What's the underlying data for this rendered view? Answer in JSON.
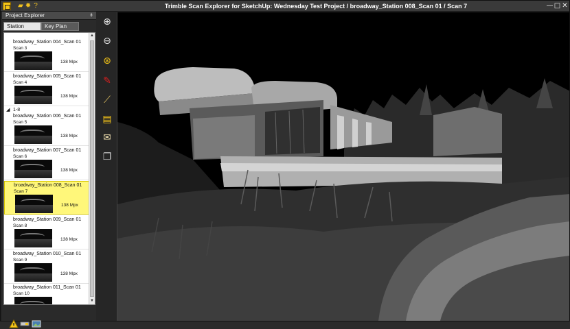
{
  "window": {
    "title": "Trimble Scan Explorer for SketchUp: Wednesday Test Project / broadway_Station 008_Scan 01 / Scan 7",
    "app_icon": "trimble-app-icon",
    "quick_access": [
      "folder-icon",
      "gear-icon",
      "help-icon"
    ],
    "quick_access_glyphs": [
      "▰",
      "✹",
      "?"
    ],
    "controls": [
      "minimize-icon",
      "maximize-icon",
      "close-icon"
    ],
    "control_glyphs": [
      "—",
      "□",
      "✕"
    ]
  },
  "panel": {
    "title": "Project Explorer",
    "pin_glyph": "⇟",
    "tabs": [
      "Station",
      "Key Plan"
    ],
    "active_tab": "Station"
  },
  "stations": [
    {
      "name": "broadway_Station 004_Scan 01",
      "scan": "Scan 3",
      "size": "138 Mpx",
      "selected": false
    },
    {
      "name": "broadway_Station 005_Scan 01",
      "scan": "Scan 4",
      "size": "138 Mpx",
      "selected": false
    },
    {
      "name": "broadway_Station 006_Scan 01",
      "scan": "Scan 5",
      "size": "138 Mpx",
      "selected": false
    },
    {
      "name": "broadway_Station 007_Scan 01",
      "scan": "Scan 6",
      "size": "138 Mpx",
      "selected": false
    },
    {
      "name": "broadway_Station 008_Scan 01",
      "scan": "Scan 7",
      "size": "138 Mpx",
      "selected": true
    },
    {
      "name": "broadway_Station 009_Scan 01",
      "scan": "Scan 8",
      "size": "138 Mpx",
      "selected": false
    },
    {
      "name": "broadway_Station 010_Scan 01",
      "scan": "Scan 9",
      "size": "138 Mpx",
      "selected": false
    },
    {
      "name": "broadway_Station 011_Scan 01",
      "scan": "Scan 10",
      "size": "138 Mpx",
      "selected": false
    }
  ],
  "group": {
    "label": "1-8",
    "expand_glyph": "◢"
  },
  "bottom_icons": [
    "warning-icon",
    "key-icon",
    "image-icon"
  ],
  "toolbar": {
    "tools": [
      {
        "name": "zoom-in-icon",
        "glyph": "⊕"
      },
      {
        "name": "zoom-out-icon",
        "glyph": "⊖"
      },
      {
        "name": "zoom-extents-icon",
        "glyph": "⊛"
      },
      {
        "name": "brush-icon",
        "glyph": "✎"
      },
      {
        "name": "measure-icon",
        "glyph": "⟋"
      },
      {
        "name": "note-icon",
        "glyph": "▤"
      },
      {
        "name": "envelope-icon",
        "glyph": "✉"
      },
      {
        "name": "pages-icon",
        "glyph": "❐"
      }
    ]
  },
  "colors": {
    "accent": "#f5c518",
    "selection": "#fff77a",
    "brush_red": "#d42020"
  }
}
